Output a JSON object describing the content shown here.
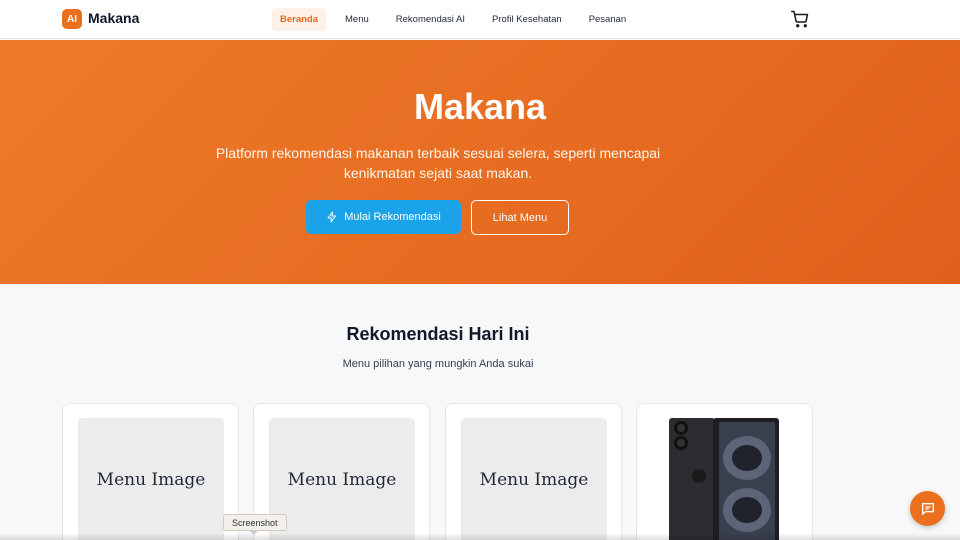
{
  "navbar": {
    "logo_text": "AI",
    "brand": "Makana",
    "links": [
      {
        "label": "Beranda",
        "active": true
      },
      {
        "label": "Menu",
        "active": false
      },
      {
        "label": "Rekomendasi AI",
        "active": false
      },
      {
        "label": "Profil Kesehatan",
        "active": false
      },
      {
        "label": "Pesanan",
        "active": false
      }
    ],
    "cart_icon": "cart-icon"
  },
  "hero": {
    "title": "Makana",
    "subtitle": "Platform rekomendasi makanan terbaik sesuai selera, seperti mencapai kenikmatan sejati saat makan.",
    "primary_button": "Mulai Rekomendasi",
    "primary_icon": "lightning-icon",
    "secondary_button": "Lihat Menu"
  },
  "section": {
    "title": "Rekomendasi Hari Ini",
    "subtitle": "Menu pilihan yang mungkin Anda sukai"
  },
  "cards": [
    {
      "image_label": "Menu Image"
    },
    {
      "image_label": "Menu Image"
    },
    {
      "image_label": "Menu Image"
    },
    {
      "image": "phone-photo"
    }
  ],
  "floating": {
    "chat_icon": "chat-icon",
    "tooltip": "Screenshot"
  },
  "colors": {
    "accent": "#ea6f1e",
    "primary_button": "#1aa3e8",
    "hero_start": "#ee7a29",
    "hero_end": "#e0601b"
  }
}
